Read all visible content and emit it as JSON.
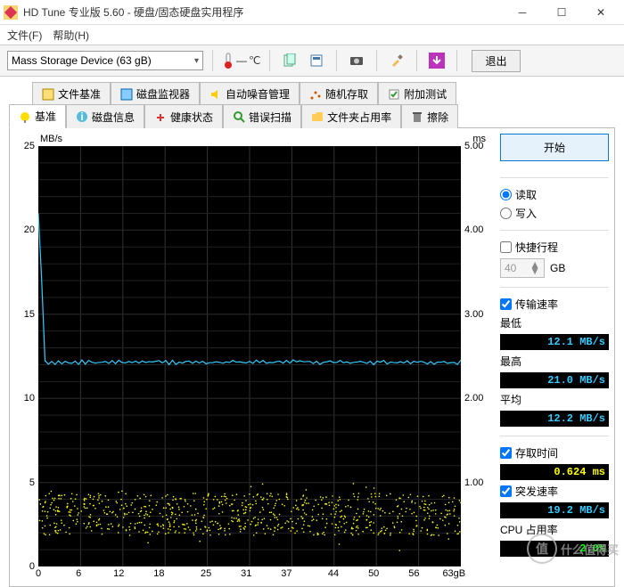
{
  "window": {
    "title": "HD Tune 专业版 5.60 - 硬盘/固态硬盘实用程序"
  },
  "menu": {
    "file": "文件(F)",
    "help": "帮助(H)"
  },
  "toolbar": {
    "device": "Mass  Storage Device (63 gB)",
    "temp_value": "—",
    "temp_unit": "℃",
    "exit": "退出"
  },
  "tabs_top": [
    {
      "label": "文件基准"
    },
    {
      "label": "磁盘监视器"
    },
    {
      "label": "自动噪音管理"
    },
    {
      "label": "随机存取"
    },
    {
      "label": "附加测试"
    }
  ],
  "tabs_bottom": [
    {
      "label": "基准",
      "active": true
    },
    {
      "label": "磁盘信息"
    },
    {
      "label": "健康状态"
    },
    {
      "label": "错误扫描"
    },
    {
      "label": "文件夹占用率"
    },
    {
      "label": "擦除"
    }
  ],
  "panel": {
    "start": "开始",
    "read": "读取",
    "write": "写入",
    "short_stroke": "快捷行程",
    "short_stroke_val": "40",
    "short_stroke_unit": "GB",
    "transfer_rate": "传输速率",
    "min_label": "最低",
    "min_val": "12.1 MB/s",
    "max_label": "最高",
    "max_val": "21.0 MB/s",
    "avg_label": "平均",
    "avg_val": "12.2 MB/s",
    "access_time": "存取时间",
    "access_val": "0.624 ms",
    "burst_rate": "突发速率",
    "burst_val": "19.2 MB/s",
    "cpu_usage": "CPU 占用率",
    "cpu_val": "2.0%"
  },
  "chart_data": {
    "type": "line",
    "title": "",
    "left_unit": "MB/s",
    "right_unit": "ms",
    "x_unit": "63gB",
    "y_left_ticks": [
      25,
      20,
      15,
      10,
      5,
      0
    ],
    "y_right_ticks": [
      "5.00",
      "4.00",
      "3.00",
      "2.00",
      "1.00"
    ],
    "x_ticks": [
      0,
      6,
      12,
      18,
      25,
      31,
      37,
      44,
      50,
      56,
      "63gB"
    ],
    "x_range": [
      0,
      63
    ],
    "y_left_range": [
      0,
      25
    ],
    "y_right_range": [
      0,
      5
    ],
    "series": [
      {
        "name": "transfer",
        "color": "#33ccff",
        "x": [
          0,
          0.5,
          1,
          63
        ],
        "y": [
          21,
          17,
          12.2,
          12.1
        ]
      },
      {
        "name": "access",
        "color": "#ffff00",
        "type": "scatter",
        "y_mean": 0.62,
        "y_spread": 0.25
      }
    ]
  },
  "watermark": {
    "text": "什么值得买",
    "badge": "值"
  }
}
